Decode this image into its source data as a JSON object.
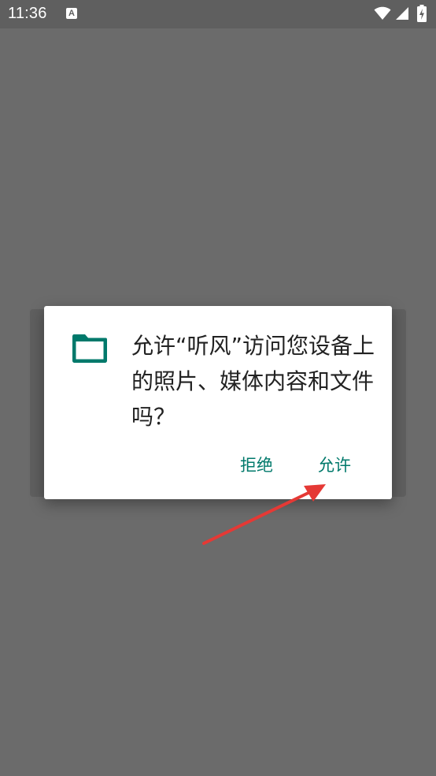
{
  "status_bar": {
    "time": "11:36",
    "notification_icon": "A"
  },
  "dialog": {
    "icon": "folder-icon",
    "message": "允许“听风”访问您设备上的照片、媒体内容和文件吗？",
    "deny_label": "拒绝",
    "allow_label": "允许"
  },
  "colors": {
    "scrim": "#6b6b6b",
    "accent": "#00796b",
    "annotation_arrow": "#e53935"
  }
}
